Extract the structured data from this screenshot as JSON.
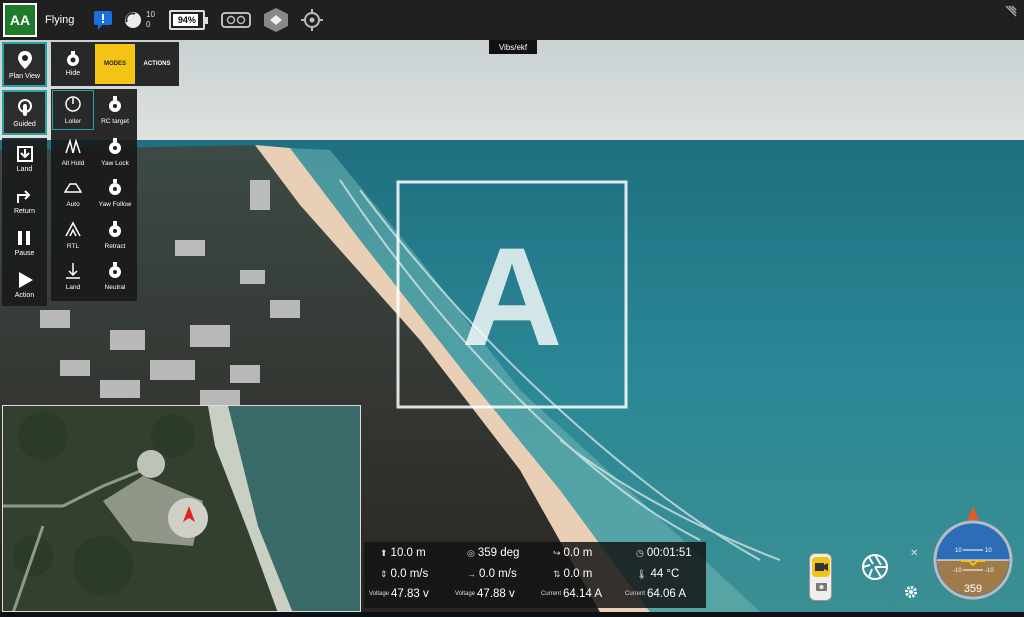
{
  "app": {
    "logo_text": "AA",
    "status": "Flying",
    "satellites": {
      "count": "10",
      "hdop": "0"
    },
    "battery_percent": "94%",
    "vibration_tab": "Vibs/ekf"
  },
  "left_toolbar": {
    "items": [
      {
        "label": "Plan View",
        "icon": "map-pin-icon"
      },
      {
        "label": "Guided",
        "icon": "touch-icon"
      },
      {
        "label": "Land",
        "icon": "land-icon"
      },
      {
        "label": "Return",
        "icon": "return-icon"
      },
      {
        "label": "Pause",
        "icon": "pause-icon"
      },
      {
        "label": "Action",
        "icon": "play-icon"
      }
    ]
  },
  "panel_tabs": {
    "hide": "Hide",
    "modes": "MODES",
    "actions": "ACTIONS"
  },
  "flight_modes": [
    {
      "label": "Loiter",
      "icon": "loiter-icon"
    },
    {
      "label": "RC target",
      "icon": "rc-target-icon"
    },
    {
      "label": "Alt Hold",
      "icon": "alt-hold-icon"
    },
    {
      "label": "Yaw Lock",
      "icon": "yaw-lock-icon"
    },
    {
      "label": "Auto",
      "icon": "auto-icon"
    },
    {
      "label": "Yaw Follow",
      "icon": "yaw-follow-icon"
    },
    {
      "label": "RTL",
      "icon": "rtl-icon"
    },
    {
      "label": "Retract",
      "icon": "retract-icon"
    },
    {
      "label": "Land",
      "icon": "land-mode-icon"
    },
    {
      "label": "Neutral",
      "icon": "neutral-icon"
    }
  ],
  "telemetry": {
    "altitude": "10.0 m",
    "heading": "359 deg",
    "distance_home": "0.0 m",
    "flight_time": "00:01:51",
    "vertical_speed": "0.0 m/s",
    "horizontal_speed": "0.0 m/s",
    "distance_travel": "0.0 m",
    "temperature": "44 °C",
    "voltage_label": "Voltage",
    "current_label": "Current",
    "voltage1": "47.83 v",
    "voltage2": "47.88 v",
    "current1": "64.14 A",
    "current2": "64.06 A"
  },
  "compass": {
    "heading": "359",
    "pitch_ticks": [
      "10",
      "10",
      "-10",
      "-10"
    ]
  },
  "colors": {
    "accent": "#f3c415",
    "selected": "#2aa3a3",
    "status_ok": "#1f7a2a"
  }
}
